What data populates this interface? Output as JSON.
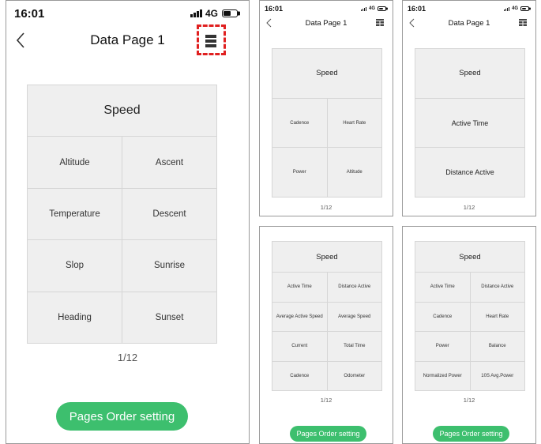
{
  "colors": {
    "accent_green": "#3dbf6e",
    "highlight_red": "#e02020",
    "grid_bg": "#efefef"
  },
  "main": {
    "status": {
      "time": "16:01",
      "network": "4G"
    },
    "title": "Data Page 1",
    "header": "Speed",
    "rows": [
      [
        "Altitude",
        "Ascent"
      ],
      [
        "Temperature",
        "Descent"
      ],
      [
        "Slop",
        "Sunrise"
      ],
      [
        "Heading",
        "Sunset"
      ]
    ],
    "page": "1/12",
    "button": "Pages Order setting"
  },
  "preview_a": {
    "status": {
      "time": "16:01",
      "network": "4G"
    },
    "title": "Data Page 1",
    "header": "Speed",
    "rows": [
      [
        "Cadence",
        "Heart Rate"
      ],
      [
        "Power",
        "Altitude"
      ]
    ],
    "page": "1/12"
  },
  "preview_b": {
    "status": {
      "time": "16:01",
      "network": "4G"
    },
    "title": "Data Page 1",
    "fields": [
      "Speed",
      "Active Time",
      "Distance Active"
    ],
    "page": "1/12"
  },
  "preview_c": {
    "header": "Speed",
    "rows": [
      [
        "Active Time",
        "Distance Active"
      ],
      [
        "Average Active Speed",
        "Average Speed"
      ],
      [
        "Current",
        "Total Time"
      ],
      [
        "Cadence",
        "Odometer"
      ]
    ],
    "page": "1/12",
    "button": "Pages Order setting"
  },
  "preview_d": {
    "header": "Speed",
    "rows": [
      [
        "Active Time",
        "Distance Active"
      ],
      [
        "Cadence",
        "Heart Rate"
      ],
      [
        "Power",
        "Balance"
      ],
      [
        "Normalized Power",
        "10S Avg.Power"
      ]
    ],
    "page": "1/12",
    "button": "Pages Order setting"
  }
}
